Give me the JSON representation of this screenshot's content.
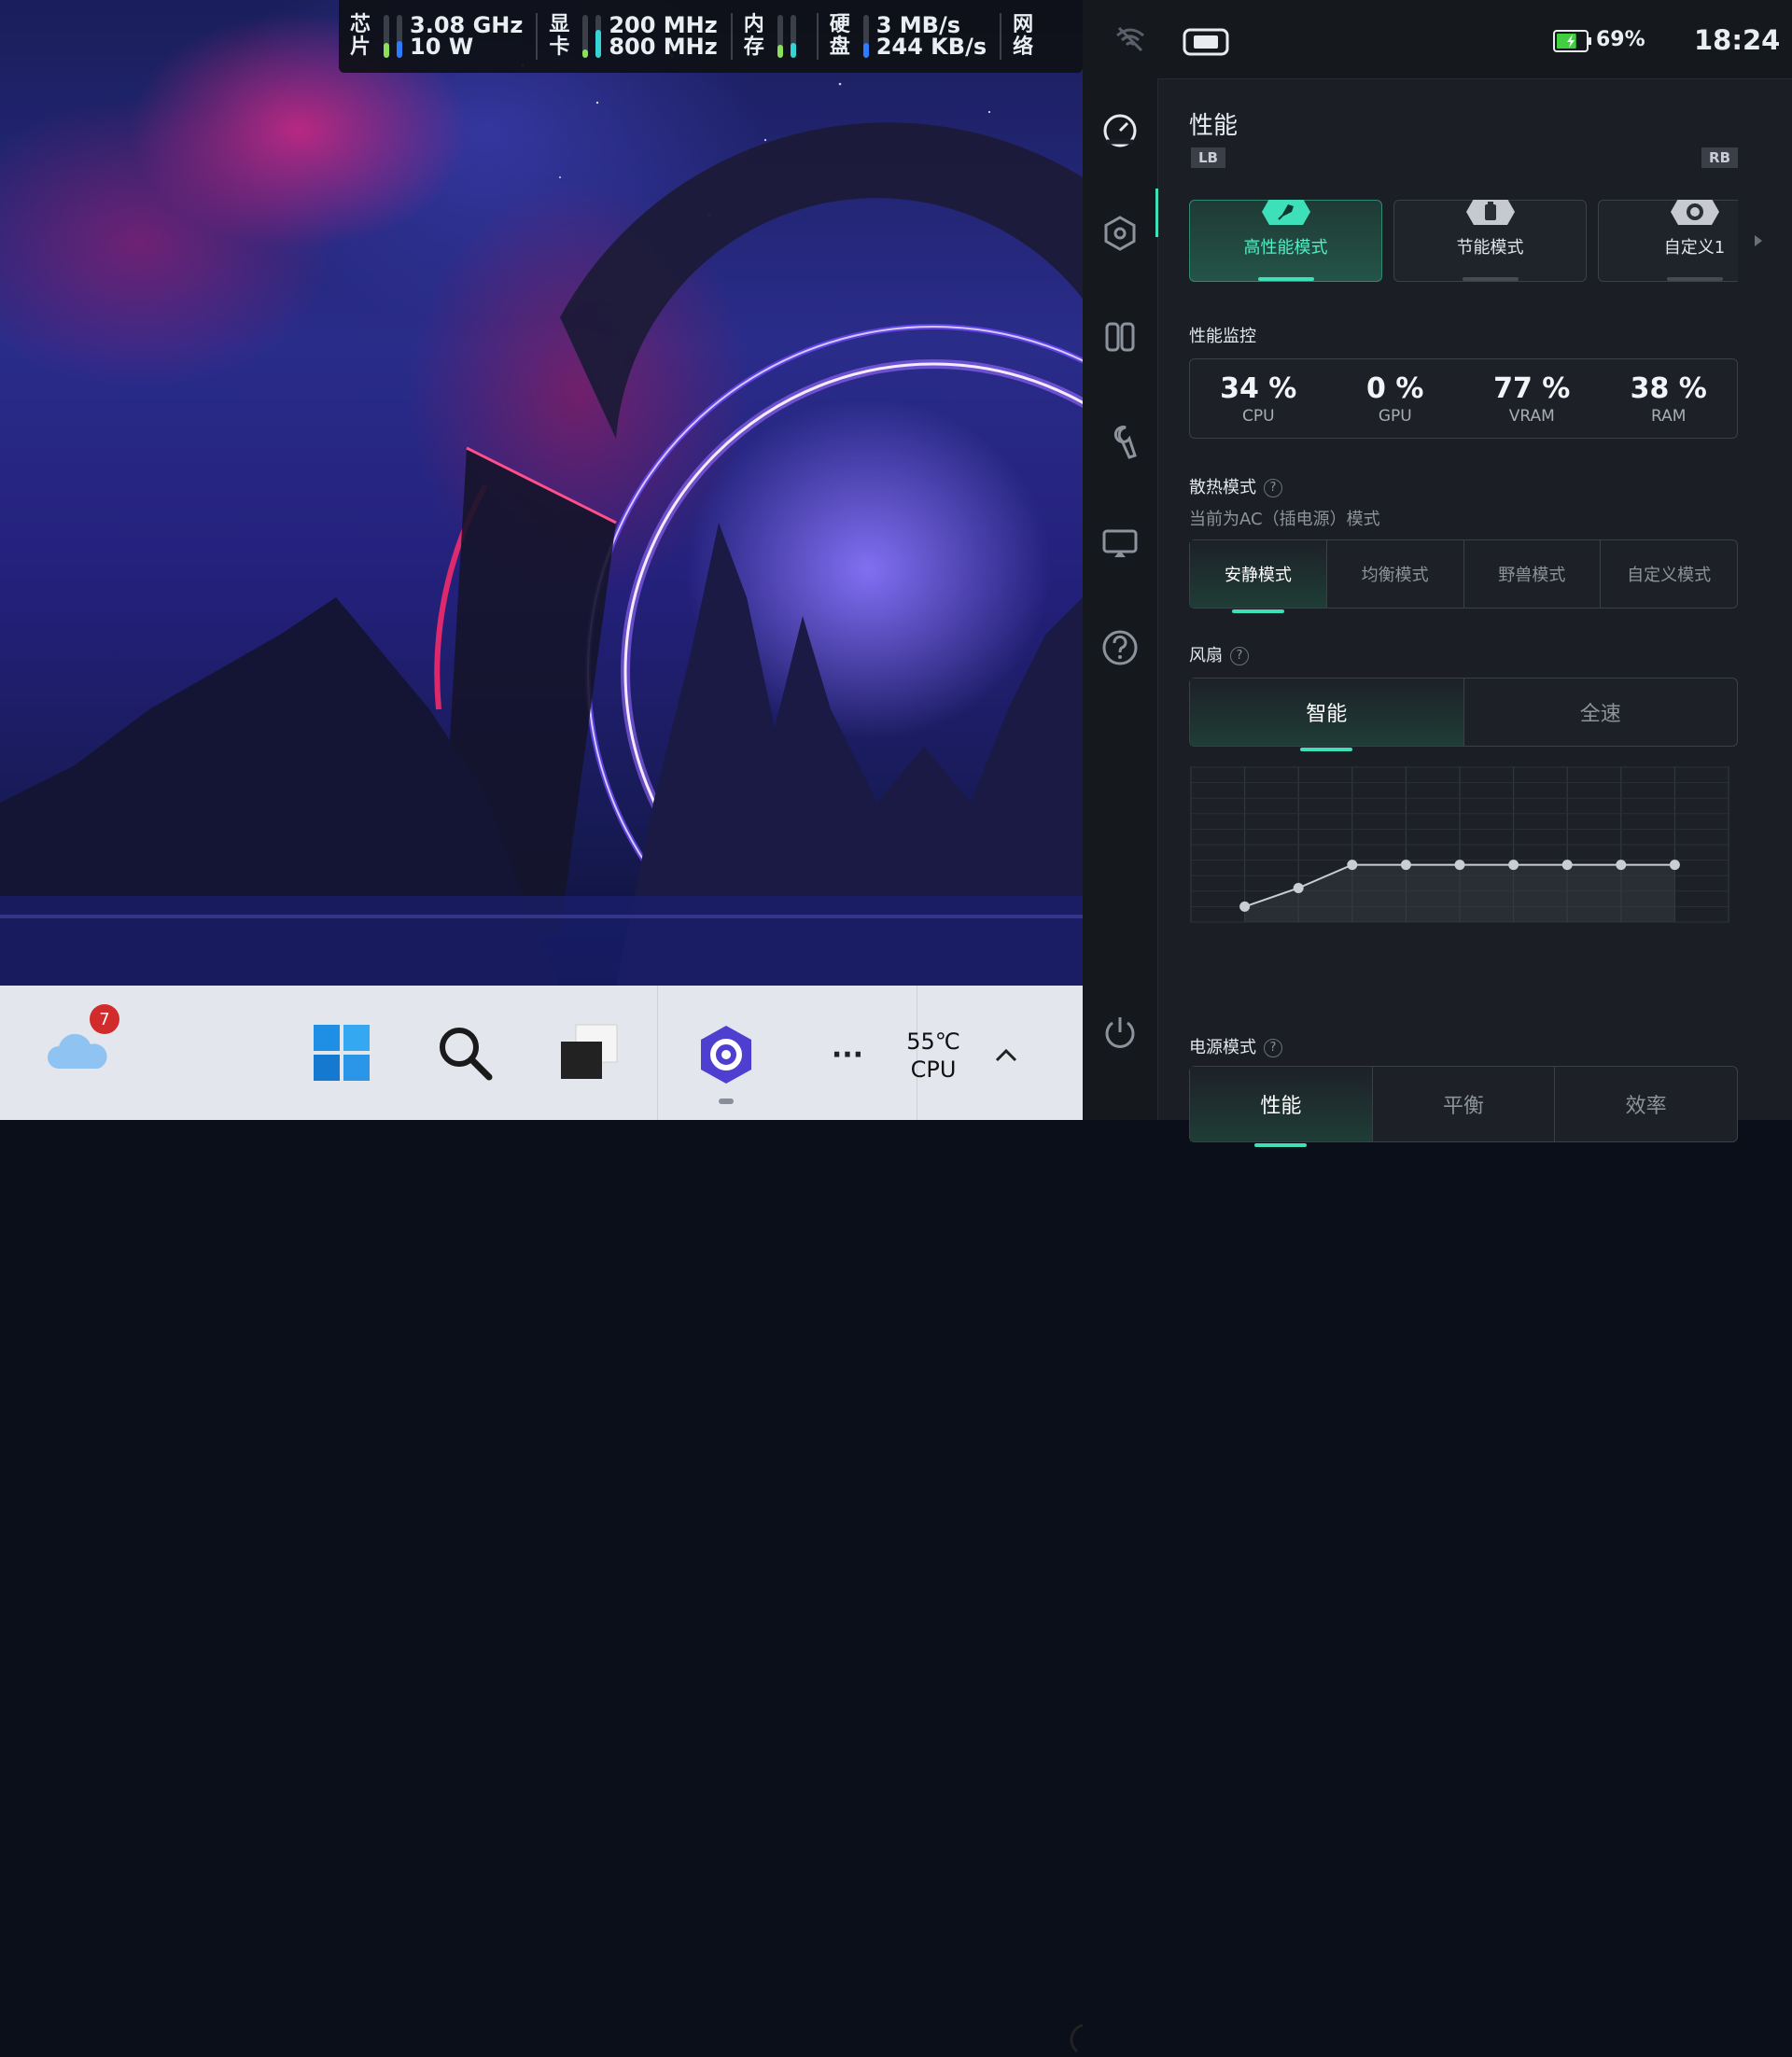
{
  "stats_overlay": {
    "chip": {
      "label_top": "芯",
      "label_bottom": "片",
      "freq": "3.08 GHz",
      "power": "10 W"
    },
    "gpu": {
      "label_top": "显",
      "label_bottom": "卡",
      "freq1": "200 MHz",
      "freq2": "800 MHz"
    },
    "memory": {
      "label_top": "内",
      "label_bottom": "存"
    },
    "disk": {
      "label_top": "硬",
      "label_bottom": "盘",
      "read": "3 MB/s",
      "write": "244 KB/s"
    },
    "network": {
      "label_top": "网",
      "label_bottom": "络"
    }
  },
  "status_bar": {
    "battery_percent": "69%",
    "time": "18:24",
    "battery_level": 0.69
  },
  "sidenav": {
    "icons": [
      "gauge-icon",
      "hexagon-settings-icon",
      "controller-icon",
      "wrench-icon",
      "display-icon",
      "help-icon",
      "power-icon"
    ]
  },
  "performance": {
    "title": "性能",
    "lb": "LB",
    "rb": "RB",
    "modes": [
      {
        "label": "高性能模式",
        "icon": "rocket-icon",
        "active": true
      },
      {
        "label": "节能模式",
        "icon": "battery-icon",
        "active": false
      },
      {
        "label": "自定义1",
        "icon": "gear-icon",
        "active": false
      }
    ],
    "monitor_title": "性能监控",
    "monitor": [
      {
        "value": "34 %",
        "name": "CPU"
      },
      {
        "value": "0 %",
        "name": "GPU"
      },
      {
        "value": "77 %",
        "name": "VRAM"
      },
      {
        "value": "38 %",
        "name": "RAM"
      }
    ],
    "cooling_title": "散热模式",
    "help_glyph": "?",
    "cooling_sub": "当前为AC（插电源）模式",
    "cooling_modes": [
      "安静模式",
      "均衡模式",
      "野兽模式",
      "自定义模式"
    ],
    "fan_title": "风扇",
    "fan_modes": [
      "智能",
      "全速"
    ],
    "power_title": "电源模式",
    "power_modes": [
      "性能",
      "平衡",
      "效率"
    ]
  },
  "chart_data": {
    "type": "line",
    "points": [
      [
        1,
        0.1
      ],
      [
        2,
        0.22
      ],
      [
        3,
        0.37
      ],
      [
        4,
        0.37
      ],
      [
        5,
        0.37
      ],
      [
        6,
        0.37
      ],
      [
        7,
        0.37
      ],
      [
        8,
        0.37
      ],
      [
        9,
        0.37
      ]
    ],
    "xlim": [
      0,
      10
    ],
    "ylim": [
      0,
      1
    ],
    "grid": true
  },
  "taskbar": {
    "weather_badge": "7",
    "temp": "55℃",
    "temp_label": "CPU",
    "more": "···",
    "chevron": "^"
  }
}
